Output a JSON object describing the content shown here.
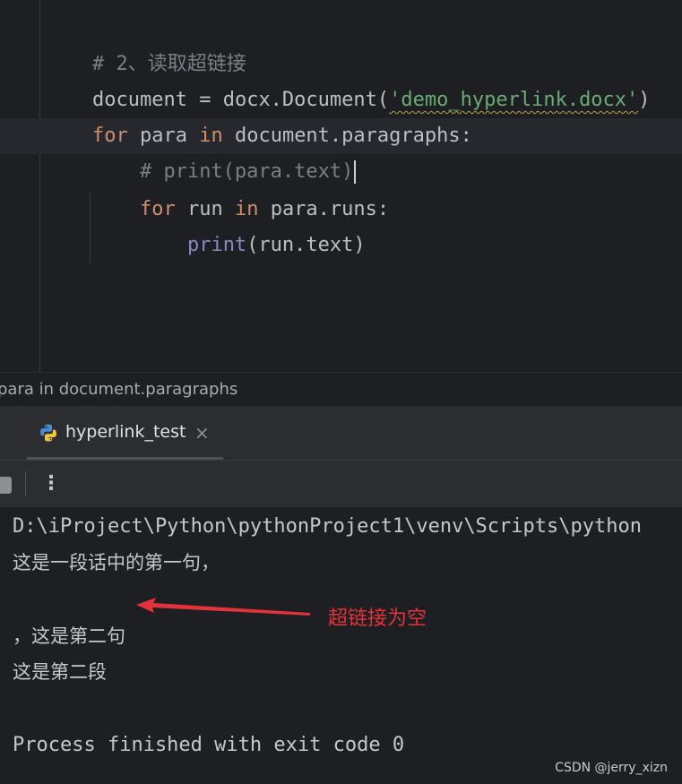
{
  "editor": {
    "lines": [
      {
        "comment": "# 2、读取超链接"
      },
      {
        "var": "document",
        "op": " = ",
        "call": "docx.Document(",
        "str": "'demo_hyperlink.docx'",
        "close": ")"
      },
      {
        "kw1": "for",
        "t1": " para ",
        "kw2": "in",
        "t2": " document.paragraphs:"
      },
      {
        "indent": "    ",
        "comment": "# print(para.text)"
      },
      {
        "indent": "    ",
        "kw1": "for",
        "t1": " run ",
        "kw2": "in",
        "t2": " para.runs:"
      },
      {
        "indent": "        ",
        "builtin": "print",
        "t": "(run.text)"
      }
    ]
  },
  "breadcrumb": "para in document.paragraphs",
  "run_panel": {
    "tab_label": "hyperlink_test",
    "close_glyph": "×",
    "more_glyph": "⋮"
  },
  "console": {
    "lines": [
      "D:\\iProject\\Python\\pythonProject1\\venv\\Scripts\\python",
      "这是一段话中的第一句，",
      "",
      "，这是第二句",
      "这是第二段",
      "",
      "Process finished with exit code 0"
    ]
  },
  "annotation": {
    "label": "超链接为空",
    "color": "#e4323a"
  },
  "watermark": "CSDN @jerry_xizn",
  "colors": {
    "background": "#1e1f22",
    "panel": "#2b2d30",
    "keyword": "#cf8e6d",
    "string": "#6aab73",
    "comment": "#7a7e85",
    "builtin": "#8888c6"
  }
}
